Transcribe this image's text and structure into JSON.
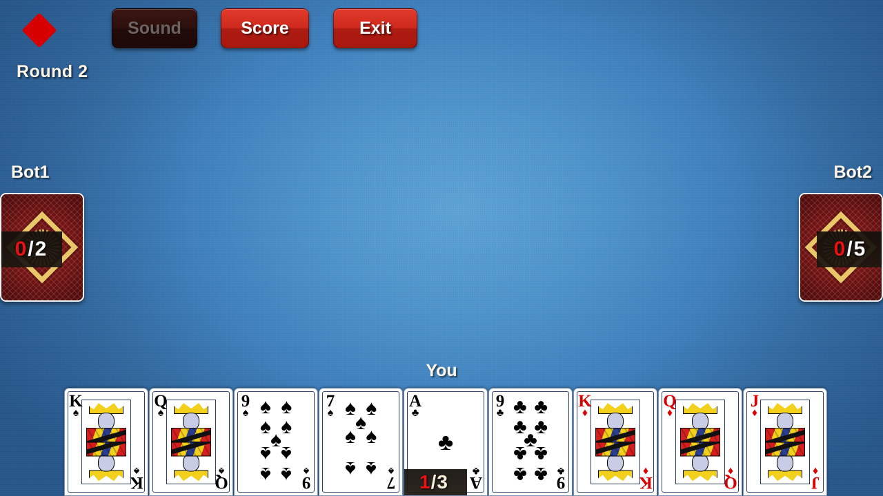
{
  "header": {
    "trump_suit_icon": "diamond-icon",
    "trump_suit": "diamonds",
    "round_label": "Round 2",
    "buttons": [
      {
        "name": "sound",
        "label": "Sound",
        "enabled": false
      },
      {
        "name": "score",
        "label": "Score",
        "enabled": true
      },
      {
        "name": "exit",
        "label": "Exit",
        "enabled": true
      }
    ]
  },
  "opponents": [
    {
      "name": "Bot1",
      "label": "Bot1",
      "tricks_won": "0",
      "separator": "/",
      "bid": "2",
      "score_text": "0/2"
    },
    {
      "name": "Bot2",
      "label": "Bot2",
      "tricks_won": "0",
      "separator": "/",
      "bid": "5",
      "score_text": "0/5"
    }
  ],
  "player": {
    "label": "You",
    "tricks_won": "1",
    "separator": "/",
    "bid": "3",
    "score_text": "1/3",
    "hand": [
      {
        "rank": "K",
        "suit": "spades",
        "suit_glyph": "♠",
        "color": "black",
        "type": "face",
        "badge": false
      },
      {
        "rank": "Q",
        "suit": "spades",
        "suit_glyph": "♠",
        "color": "black",
        "type": "face",
        "badge": false
      },
      {
        "rank": "9",
        "suit": "spades",
        "suit_glyph": "♠",
        "color": "black",
        "type": "number",
        "badge": false
      },
      {
        "rank": "7",
        "suit": "spades",
        "suit_glyph": "♠",
        "color": "black",
        "type": "number",
        "badge": false
      },
      {
        "rank": "A",
        "suit": "clubs",
        "suit_glyph": "♣",
        "color": "black",
        "type": "ace",
        "badge": true
      },
      {
        "rank": "9",
        "suit": "clubs",
        "suit_glyph": "♣",
        "color": "black",
        "type": "number",
        "badge": false
      },
      {
        "rank": "K",
        "suit": "diamonds",
        "suit_glyph": "♦",
        "color": "red",
        "type": "face",
        "badge": false
      },
      {
        "rank": "Q",
        "suit": "diamonds",
        "suit_glyph": "♦",
        "color": "red",
        "type": "face",
        "badge": false
      },
      {
        "rank": "J",
        "suit": "diamonds",
        "suit_glyph": "♦",
        "color": "red",
        "type": "face",
        "badge": false
      }
    ]
  },
  "colors": {
    "table_center": "#5ea3d6",
    "table_edge": "#27578b",
    "button_red": "#cf2a1d",
    "trump_red": "#d60000",
    "card_back_red": "#7a1616",
    "card_back_gold": "#e9c86a",
    "text_cream": "#fdf6ea",
    "score_won_red": "#ee1111"
  }
}
